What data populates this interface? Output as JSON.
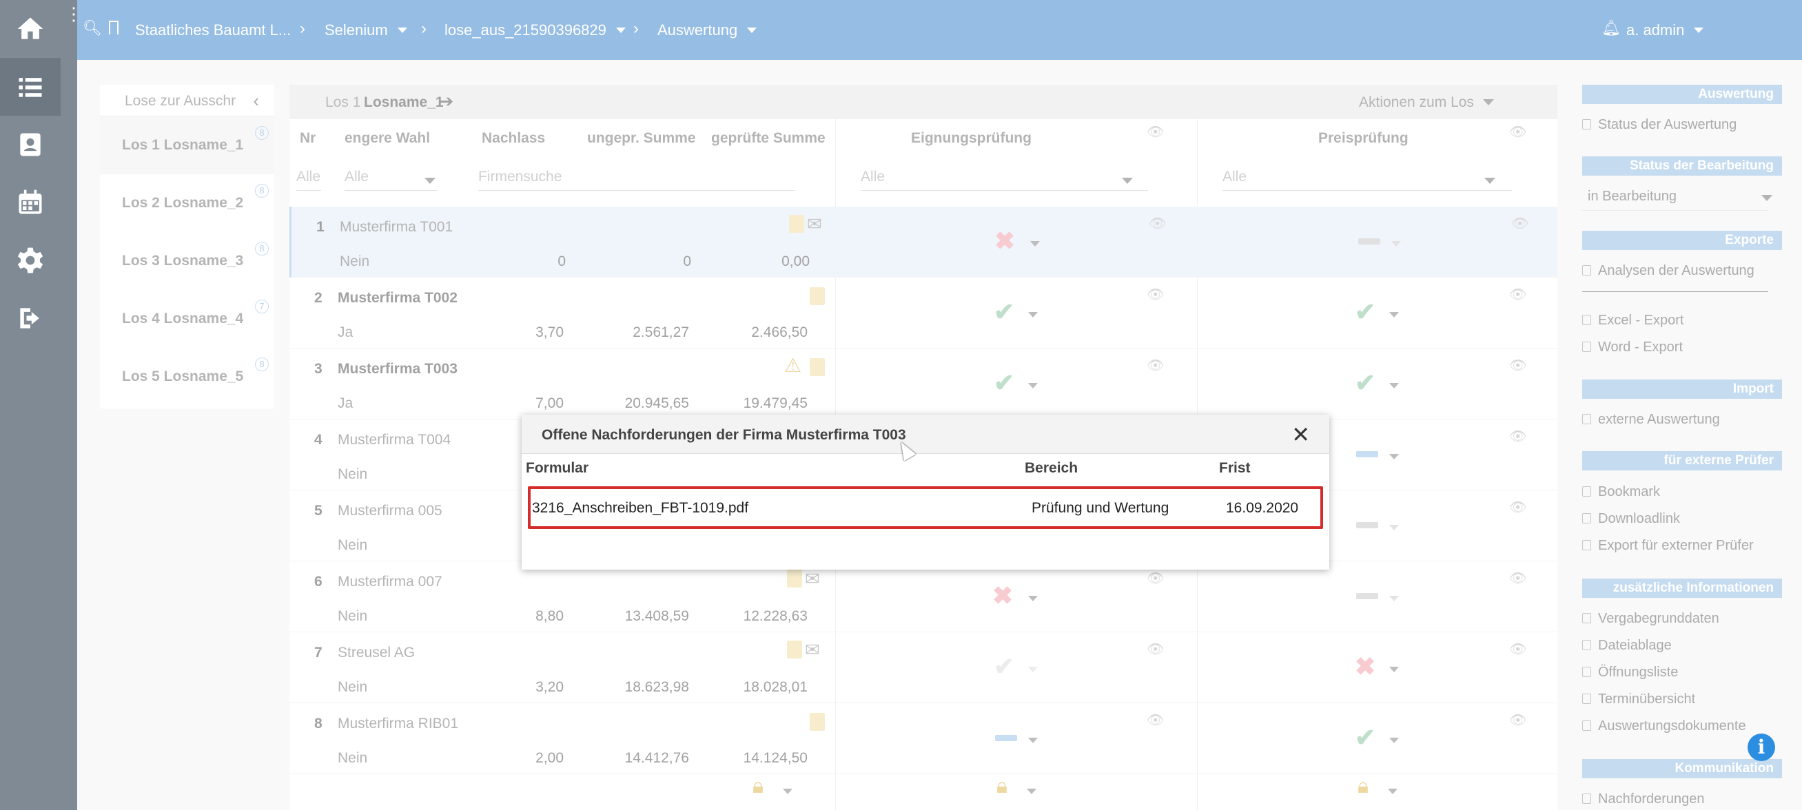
{
  "topbar": {
    "crumbs": [
      "Staatliches Bauamt L...",
      "Selenium",
      "lose_aus_21590396829",
      "Auswertung"
    ],
    "user": "a. admin"
  },
  "lots_panel": {
    "header": "Lose zur Ausschr",
    "lots": [
      {
        "label": "Los 1 Losname_1",
        "count": "8"
      },
      {
        "label": "Los 2 Losname_2",
        "count": "8"
      },
      {
        "label": "Los 3 Losname_3",
        "count": "8"
      },
      {
        "label": "Los 4 Losname_4",
        "count": "7"
      },
      {
        "label": "Los 5 Losname_5",
        "count": "8"
      }
    ]
  },
  "main": {
    "los_prefix": "Los 1",
    "los_name": "Losname_1",
    "actions": "Aktionen zum Los",
    "columns": [
      "Nr",
      "engere Wahl",
      "Nachlass",
      "ungepr. Summe",
      "geprüfte Summe",
      "Eignungsprüfung",
      "Preisprüfung"
    ],
    "filters": {
      "nr": "Alle",
      "engere_wahl": "Alle",
      "firma": "Firmensuche",
      "eignung": "Alle",
      "preis": "Alle"
    },
    "rows": [
      {
        "nr": "1",
        "firma": "Musterfirma T001",
        "ew": "Nein",
        "nachlass": "0",
        "ungepr": "0",
        "gepr": "0,00"
      },
      {
        "nr": "2",
        "firma": "Musterfirma T002",
        "ew": "Ja",
        "nachlass": "3,70",
        "ungepr": "2.561,27",
        "gepr": "2.466,50"
      },
      {
        "nr": "3",
        "firma": "Musterfirma T003",
        "ew": "Ja",
        "nachlass": "7,00",
        "ungepr": "20.945,65",
        "gepr": "19.479,45"
      },
      {
        "nr": "4",
        "firma": "Musterfirma T004",
        "ew": "Nein",
        "nachlass": "",
        "ungepr": "",
        "gepr": ""
      },
      {
        "nr": "5",
        "firma": "Musterfirma 005",
        "ew": "Nein",
        "nachlass": "",
        "ungepr": "",
        "gepr": ""
      },
      {
        "nr": "6",
        "firma": "Musterfirma 007",
        "ew": "Nein",
        "nachlass": "8,80",
        "ungepr": "13.408,59",
        "gepr": "12.228,63"
      },
      {
        "nr": "7",
        "firma": "Streusel AG",
        "ew": "Nein",
        "nachlass": "3,20",
        "ungepr": "18.623,98",
        "gepr": "18.028,01"
      },
      {
        "nr": "8",
        "firma": "Musterfirma RIB01",
        "ew": "Nein",
        "nachlass": "2,00",
        "ungepr": "14.412,76",
        "gepr": "14.124,50"
      }
    ]
  },
  "sidebar": {
    "auswertung": {
      "title": "Auswertung",
      "items": [
        "Status der Auswertung"
      ]
    },
    "status": {
      "title": "Status der Bearbeitung",
      "value": "in Bearbeitung"
    },
    "exporte": {
      "title": "Exporte",
      "items": [
        "Analysen der Auswertung",
        "Excel - Export",
        "Word - Export"
      ]
    },
    "import": {
      "title": "Import",
      "items": [
        "externe Auswertung"
      ]
    },
    "extern": {
      "title": "für externe Prüfer",
      "items": [
        "Bookmark",
        "Downloadlink",
        "Export für externer Prüfer"
      ]
    },
    "info": {
      "title": "zusätzliche Informationen",
      "items": [
        "Vergabegrunddaten",
        "Dateiablage",
        "Öffnungsliste",
        "Terminübersicht",
        "Auswertungsdokumente"
      ]
    },
    "komm": {
      "title": "Kommunikation",
      "items": [
        "Nachforderungen"
      ]
    }
  },
  "modal": {
    "title": "Offene Nachforderungen der Firma Musterfirma T003",
    "headers": {
      "formular": "Formular",
      "bereich": "Bereich",
      "frist": "Frist"
    },
    "row": {
      "formular": "3216_Anschreiben_FBT-1019.pdf",
      "bereich": "Prüfung und Wertung",
      "frist": "16.09.2020"
    }
  },
  "colors": {
    "accent": "#96bde4",
    "highlight": "#d52b2b"
  }
}
